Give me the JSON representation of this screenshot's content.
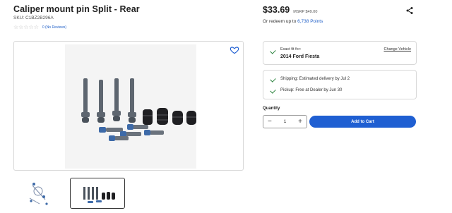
{
  "product": {
    "title": "Caliper mount pin Split - Rear",
    "sku": "SKU: C1BZ2B296A",
    "rating_count": "0 (No Reviews)",
    "star_icon": "star-outline-icon",
    "stars_filled": 0,
    "stars_total": 5
  },
  "pricing": {
    "price": "$33.69",
    "msrp": "MSRP $49.00",
    "redeem_prefix": "Or redeem up to ",
    "redeem_points": "6,738 Points"
  },
  "fitment": {
    "label": "Exact fit for:",
    "vehicle": "2014 Ford Fiesta",
    "change_link": "Change Vehicle"
  },
  "shipping": {
    "shipping_text": "Shipping: Estimated delivery by Jul 2",
    "pickup_text": "Pickup: Free at Dealer by Jun 30"
  },
  "quantity": {
    "label": "Quantity",
    "value": "1",
    "minus": "−",
    "plus": "+"
  },
  "cart": {
    "add_label": "Add to Cart"
  },
  "colors": {
    "accent": "#1f5fd2",
    "check": "#2e8540",
    "link": "#2060c8"
  },
  "icons": [
    "heart-icon",
    "share-icon",
    "check-icon",
    "minus-icon",
    "plus-icon"
  ]
}
